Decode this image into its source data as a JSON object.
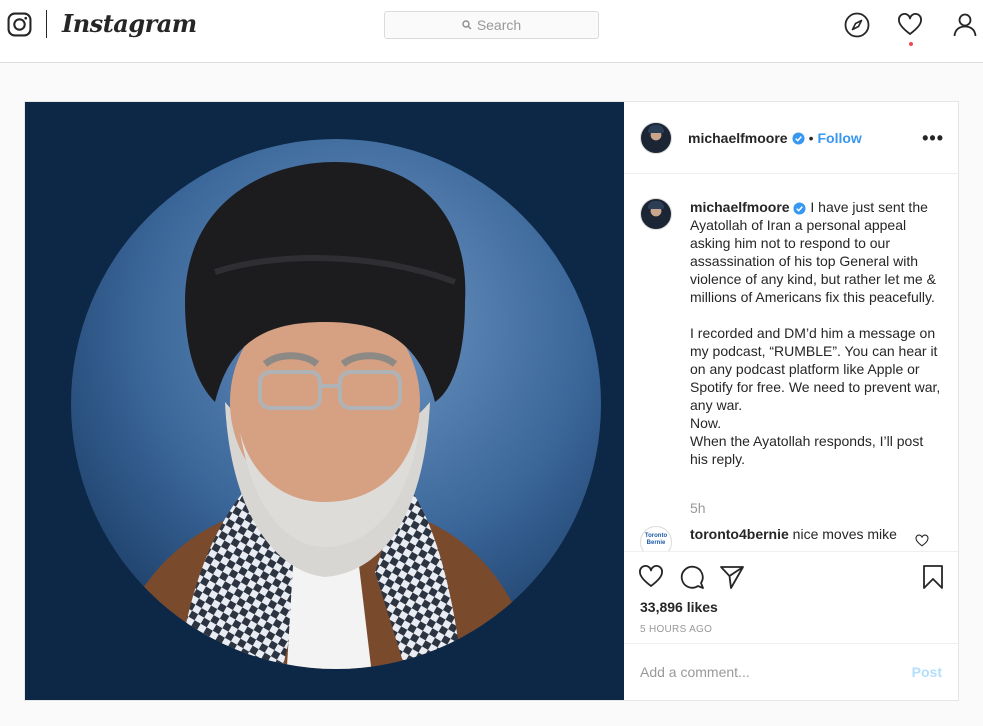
{
  "nav": {
    "logo_text": "Instagram",
    "search_placeholder": "Search",
    "icons": [
      "instagram-glyph-icon",
      "compass-icon",
      "heart-icon",
      "profile-icon"
    ]
  },
  "post": {
    "image_alt": "Portrait of the Ayatollah in a circular frame",
    "author": "michaelfmoore",
    "verified": true,
    "follow_separator": "•",
    "follow_label": "Follow",
    "more_label": "•••",
    "caption_paragraphs": [
      "I have just sent the Ayatollah of Iran a personal appeal asking him not to respond to our assassination of his top General with violence of any kind, but rather let me & millions of Americans fix this peacefully.",
      "I recorded and DM’d him a message on my podcast, “RUMBLE”. You can hear it on any podcast platform like Apple or Spotify for free. We need to prevent war, any war.",
      "Now.",
      "When the Ayatollah responds, I’ll post his reply."
    ],
    "caption_time": "5h",
    "comment": {
      "avatar_text": "Toronto Bernie",
      "user": "toronto4bernie",
      "text": "nice moves mike"
    },
    "likes": "33,896 likes",
    "timestamp": "5 HOURS AGO",
    "add_comment_placeholder": "Add a comment...",
    "post_label": "Post"
  },
  "colors": {
    "link_blue": "#3897f0",
    "media_bg": "#0c2846",
    "notif_red": "#ed4956"
  }
}
